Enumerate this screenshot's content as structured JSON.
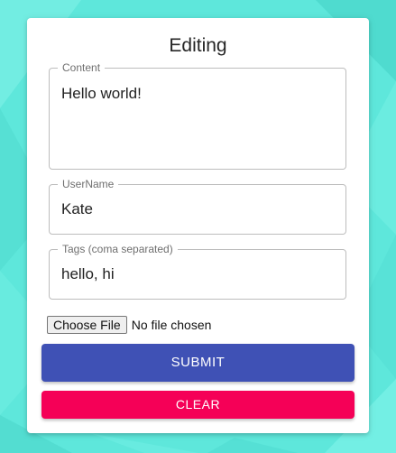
{
  "form": {
    "title": "Editing",
    "content": {
      "label": "Content",
      "value": "Hello world!"
    },
    "username": {
      "label": "UserName",
      "value": "Kate"
    },
    "tags": {
      "label": "Tags (coma separated)",
      "value": "hello, hi"
    },
    "file": {
      "button_label": "Choose File",
      "status": "No file chosen"
    },
    "submit_label": "SUBMIT",
    "clear_label": "CLEAR"
  },
  "colors": {
    "background": "#5fe8dc",
    "submit": "#3f51b5",
    "clear": "#f50057"
  }
}
